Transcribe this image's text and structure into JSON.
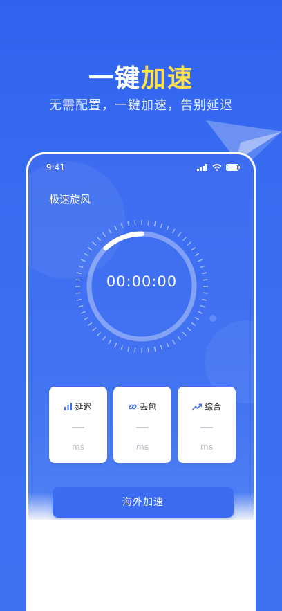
{
  "promo": {
    "headline_part1": "一键",
    "headline_part2": "加速",
    "subtitle": "无需配置，一键加速，告别延迟"
  },
  "status_bar": {
    "time": "9:41"
  },
  "app": {
    "title": "极速旋风",
    "timer": "00:00:00",
    "progress_fraction": 0.12
  },
  "stats": [
    {
      "label": "延迟",
      "value": "—",
      "unit": "ms",
      "icon": "bar-chart-icon"
    },
    {
      "label": "丢包",
      "value": "—",
      "unit": "ms",
      "icon": "link-icon"
    },
    {
      "label": "综合",
      "value": "—",
      "unit": "ms",
      "icon": "trend-up-icon"
    }
  ],
  "action": {
    "button_label": "海外加速"
  },
  "colors": {
    "primary": "#3b6cf2",
    "accent": "#ffe04a"
  }
}
